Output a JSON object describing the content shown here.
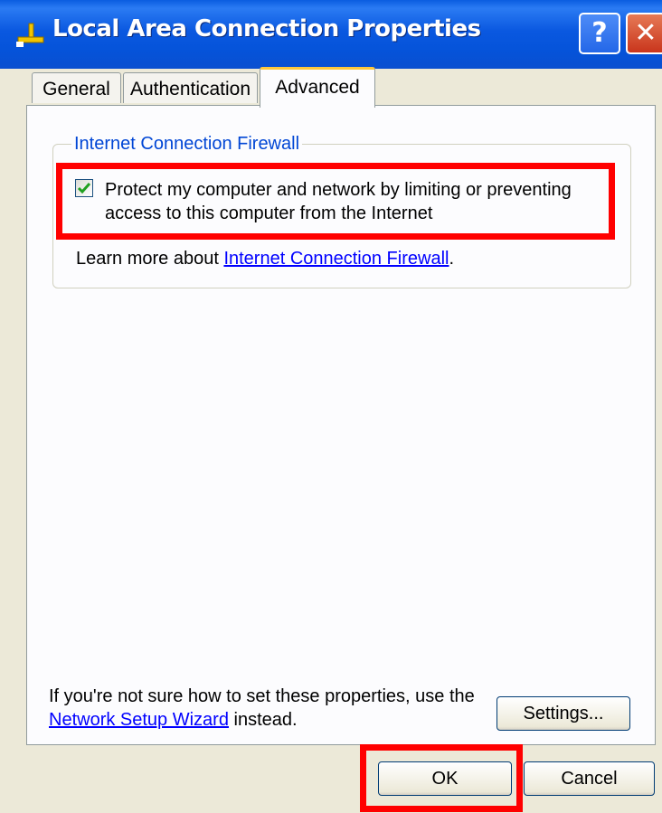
{
  "window": {
    "title": "Local Area Connection Properties",
    "help_button": "?",
    "close_button": "✕"
  },
  "tabs": [
    {
      "label": "General"
    },
    {
      "label": "Authentication"
    },
    {
      "label": "Advanced"
    }
  ],
  "firewall": {
    "group_title": "Internet Connection Firewall",
    "checkbox_label": "Protect my computer and network by limiting or preventing access to this computer from the Internet",
    "checked": true,
    "learn_prefix": "Learn more about ",
    "learn_link": "Internet Connection Firewall",
    "learn_suffix": "."
  },
  "footer_hint": {
    "text_before": "If you're not sure how to set these properties, use the ",
    "link": "Network Setup Wizard",
    "text_after": " instead."
  },
  "buttons": {
    "settings": "Settings...",
    "ok": "OK",
    "cancel": "Cancel"
  },
  "colors": {
    "titlebar": "#0a58e0",
    "highlight": "#ff0000",
    "link": "#0000ff",
    "group_title": "#0046d5"
  }
}
